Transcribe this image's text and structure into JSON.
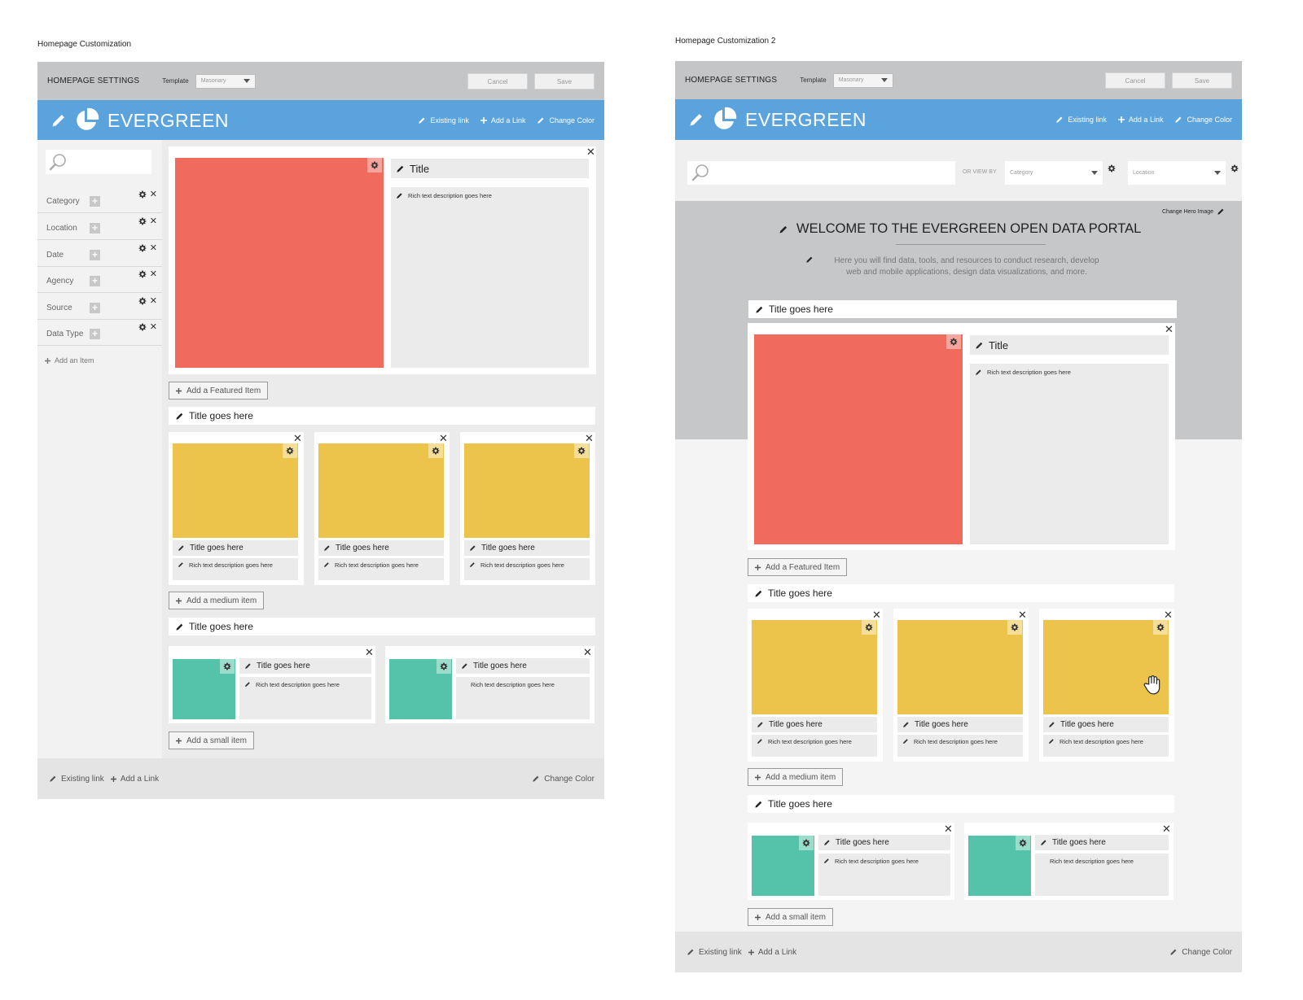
{
  "frames": [
    {
      "label": "Homepage Customization",
      "settings": {
        "title": "HOMEPAGE SETTINGS",
        "template_label": "Template",
        "template_value": "Masonary",
        "cancel": "Cancel",
        "save": "Save"
      },
      "brand": {
        "name": "EVERGREEN",
        "links": [
          "Existing link",
          "Add a Link",
          "Change Color"
        ]
      },
      "sidebar": {
        "facets": [
          "Category",
          "Location",
          "Date",
          "Agency",
          "Source",
          "Data Type"
        ],
        "add_item": "Add an Item"
      },
      "featured": {
        "title": "Title",
        "description": "Rich text description goes here",
        "add_button": "Add a Featured Item"
      },
      "medium_section": {
        "title": "Title goes here",
        "cards": [
          {
            "title": "Title goes here",
            "description": "Rich text description goes here"
          },
          {
            "title": "Title goes here",
            "description": "Rich text description goes here"
          },
          {
            "title": "Title goes here",
            "description": "Rich text description goes here"
          }
        ],
        "add_button": "Add a medium item"
      },
      "small_section": {
        "title": "Title goes here",
        "cards": [
          {
            "title": "Title goes here",
            "description": "Rich text description goes here"
          },
          {
            "title": "Title goes here",
            "description": "Rich text description goes here"
          }
        ],
        "add_button": "Add a small item"
      },
      "footer": {
        "links": [
          "Existing link",
          "Add a Link"
        ],
        "change_color": "Change Color"
      }
    },
    {
      "label": "Homepage Customization 2",
      "settings": {
        "title": "HOMEPAGE SETTINGS",
        "template_label": "Template",
        "template_value": "Masonary",
        "cancel": "Cancel",
        "save": "Save"
      },
      "brand": {
        "name": "EVERGREEN",
        "links": [
          "Existing link",
          "Add a Link",
          "Change Color"
        ]
      },
      "filter": {
        "or_view_by": "OR VIEW BY",
        "category": "Category",
        "location": "Location"
      },
      "hero": {
        "change_image": "Change Hero Image",
        "title": "WELCOME TO THE EVERGREEN OPEN DATA PORTAL",
        "subtitle_line1": "Here you will find data, tools, and resources to conduct research, develop",
        "subtitle_line2": "web and mobile applications, design data visualizations, and more."
      },
      "featured": {
        "section_title": "Title goes here",
        "title": "Title",
        "description": "Rich text description goes here",
        "add_button": "Add a Featured Item"
      },
      "medium_section": {
        "title": "Title goes here",
        "cards": [
          {
            "title": "Title goes here",
            "description": "Rich text description goes here"
          },
          {
            "title": "Title goes here",
            "description": "Rich text description goes here"
          },
          {
            "title": "Title goes here",
            "description": "Rich text description goes here"
          }
        ],
        "add_button": "Add a medium item"
      },
      "small_section": {
        "title": "Title goes here",
        "cards": [
          {
            "title": "Title goes here",
            "description": "Rich text description goes here"
          },
          {
            "title": "Title goes here",
            "description": "Rich text description goes here"
          }
        ],
        "add_button": "Add a small item"
      },
      "footer": {
        "links": [
          "Existing link",
          "Add a Link"
        ],
        "change_color": "Change Color"
      }
    }
  ],
  "colors": {
    "brand_blue": "#5ba3dc",
    "featured_red": "#f06b5e",
    "medium_yellow": "#ecc44b",
    "small_teal": "#55c2aa",
    "settings_grey": "#c4c5c7"
  },
  "icons": [
    "pencil-icon",
    "pie-logo-icon",
    "plus-icon",
    "gear-icon",
    "close-icon",
    "search-icon",
    "hand-cursor-icon",
    "chevron-down-icon"
  ]
}
